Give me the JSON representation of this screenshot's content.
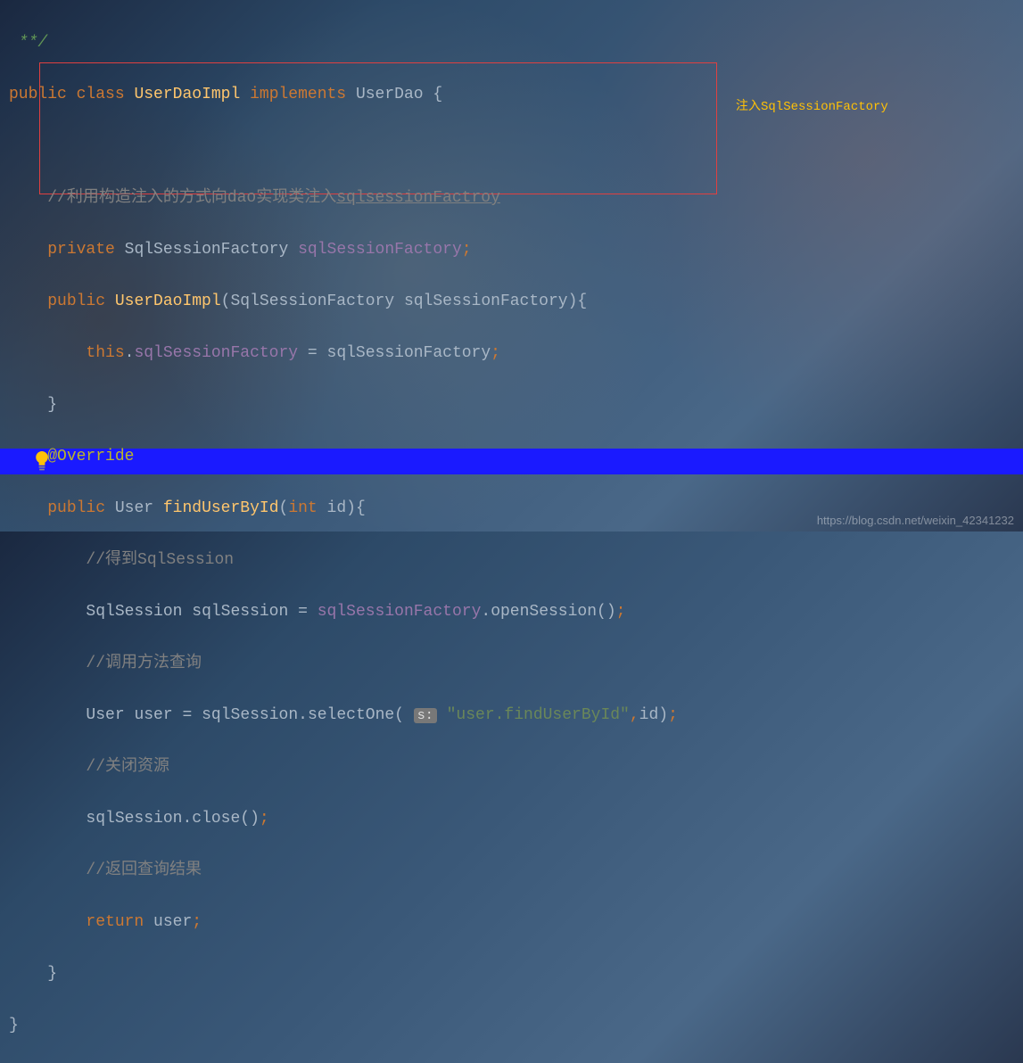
{
  "topFragment": " **/",
  "line1": {
    "kw_public": "public",
    "kw_class": "class",
    "className": "UserDaoImpl",
    "kw_implements": "implements",
    "interfaceName": "UserDao",
    "brace": " {"
  },
  "boxed": {
    "comment1_prefix": "//利用构造注入的方式向dao实现类注入",
    "comment1_link": "sqlsessionFactroy",
    "line2_private": "private",
    "line2_type": "SqlSessionFactory",
    "line2_field": "sqlSessionFactory",
    "line3_public": "public",
    "line3_ctor": "UserDaoImpl",
    "line3_paramType": "SqlSessionFactory",
    "line3_paramName": "sqlSessionFactory",
    "line4_this": "this",
    "line4_field": "sqlSessionFactory",
    "line4_rhs": "sqlSessionFactory"
  },
  "annotationLabel": "注入SqlSessionFactory",
  "override": "@Override",
  "method": {
    "kw_public": "public",
    "ret": "User",
    "name": "findUserById",
    "paramType": "int",
    "paramName": "id",
    "comment_getSession": "//得到SqlSession",
    "sess_type": "SqlSession",
    "sess_var": "sqlSession",
    "sess_factory": "sqlSessionFactory",
    "sess_method": "openSession",
    "comment_query": "//调用方法查询",
    "user_type": "User",
    "user_var": "user",
    "selectOne": "selectOne",
    "hint": "s:",
    "queryStr": "\"user.findUserById\"",
    "argId": "id",
    "comment_close": "//关闭资源",
    "close_call": "close",
    "comment_return": "//返回查询结果",
    "return_kw": "return",
    "return_var": "user"
  },
  "closeBrace1": "    }",
  "closeBrace2": "}",
  "watermark": "https://blog.csdn.net/weixin_42341232"
}
